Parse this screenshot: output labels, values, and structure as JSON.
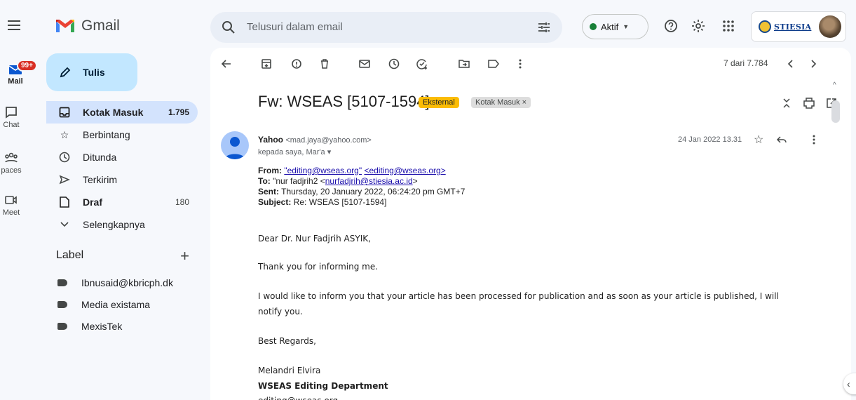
{
  "header": {
    "app_name": "Gmail",
    "search_placeholder": "Telusuri dalam email",
    "status_label": "Aktif",
    "account_org": "STIESIA"
  },
  "rail": {
    "mail_badge": "99+",
    "items": [
      {
        "label": "Mail"
      },
      {
        "label": "Chat"
      },
      {
        "label": "paces"
      },
      {
        "label": "Meet"
      }
    ]
  },
  "compose": {
    "label": "Tulis"
  },
  "nav": [
    {
      "label": "Kotak Masuk",
      "count": "1.795"
    },
    {
      "label": "Berbintang"
    },
    {
      "label": "Ditunda"
    },
    {
      "label": "Terkirim"
    },
    {
      "label": "Draf",
      "count": "180"
    },
    {
      "label": "Selengkapnya"
    }
  ],
  "labels": {
    "title": "Label",
    "add": "+",
    "items": [
      {
        "label": "Ibnusaid@kbricph.dk"
      },
      {
        "label": "Media existama"
      },
      {
        "label": "MexisTek"
      }
    ]
  },
  "toolbar": {
    "pager": "7 dari 7.784"
  },
  "email": {
    "subject": "Fw: WSEAS [5107-1594]",
    "chip_external": "Eksternal",
    "chip_inbox": "Kotak Masuk ×",
    "sender_name": "Yahoo",
    "sender_email": "<mad.jaya@yahoo.com>",
    "recipient": "kepada saya, Mar'a ▾",
    "date": "24 Jan 2022 13.31",
    "from_label": "From:",
    "from_name": "\"editing@wseas.org\"",
    "from_email": "<editing@wseas.org>",
    "to_label": "To:",
    "to_name": "\"nur fadjrih2 <",
    "to_email": "nurfadjrih@stiesia.ac.id",
    "to_end": ">",
    "sent_label": "Sent:",
    "sent_value": "Thursday, 20 January 2022, 06:24:20 pm GMT+7",
    "subject_label": "Subject:",
    "subject_value": "Re: WSEAS [5107-1594]",
    "greeting": "Dear Dr. Nur Fadjrih ASYIK,",
    "p1": "Thank you for informing me.",
    "p2a": "I would like to inform you that your article has been processed for publication and as soon as your article is published, I will",
    "p2b": "notify you.",
    "regards": "Best Regards,",
    "sig_name": "Melandri Elvira",
    "sig_dept": "WSEAS Editing Department",
    "sig_email": "editing@wseas.org"
  }
}
